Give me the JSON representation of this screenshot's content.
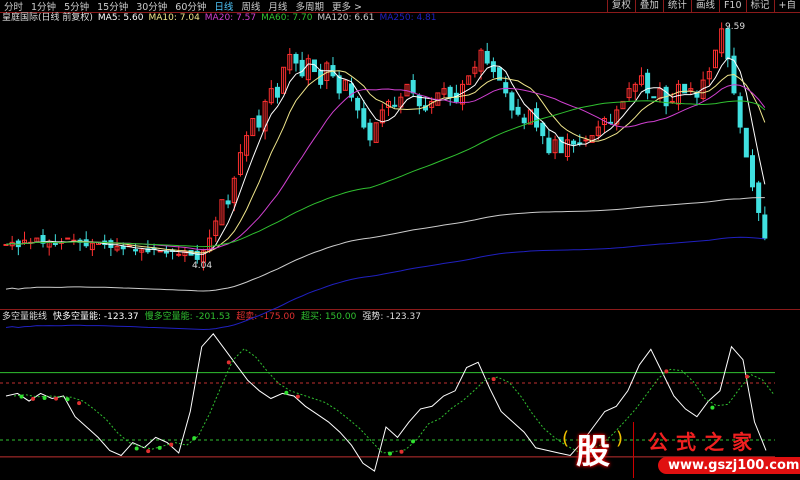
{
  "toolbar": {
    "periods": [
      "分时",
      "1分钟",
      "5分钟",
      "15分钟",
      "30分钟",
      "60分钟",
      "日线",
      "周线",
      "月线",
      "多周期",
      "更多 >"
    ],
    "active": 6,
    "tools": [
      "复权",
      "叠加",
      "统计",
      "画线",
      "F10",
      "标记",
      "+自"
    ]
  },
  "legend": {
    "title": "皇庭国际(日线 前复权)",
    "ma": [
      {
        "label": "MA5: 5.60",
        "color": "#ffffff"
      },
      {
        "label": "MA10: 7.04",
        "color": "#f0e68c"
      },
      {
        "label": "MA20: 7.57",
        "color": "#d040d0"
      },
      {
        "label": "MA60: 7.70",
        "color": "#30c030"
      },
      {
        "label": "MA120: 6.61",
        "color": "#cccccc"
      },
      {
        "label": "MA250: 4.81",
        "color": "#2020c0"
      }
    ]
  },
  "price_labels": {
    "high": "9.59",
    "low": "4.04"
  },
  "colors": {
    "up": "#ff3030",
    "down": "#40e0e0"
  },
  "closes": [
    4.45,
    4.5,
    4.4,
    4.55,
    4.5,
    4.6,
    4.48,
    4.52,
    4.45,
    4.5,
    4.6,
    4.55,
    4.5,
    4.42,
    4.48,
    4.5,
    4.45,
    4.38,
    4.4,
    4.35,
    4.42,
    4.3,
    4.32,
    4.28,
    4.35,
    4.3,
    4.25,
    4.3,
    4.22,
    4.28,
    4.2,
    4.1,
    4.3,
    4.6,
    5.0,
    5.5,
    5.4,
    6.0,
    6.6,
    7.0,
    7.4,
    7.2,
    7.8,
    8.1,
    7.9,
    8.6,
    8.9,
    8.7,
    8.4,
    8.8,
    8.5,
    8.2,
    8.7,
    8.4,
    8.0,
    8.3,
    7.9,
    7.6,
    7.2,
    6.9,
    7.3,
    7.6,
    7.8,
    7.7,
    7.9,
    8.2,
    8.0,
    7.7,
    7.6,
    7.8,
    8.0,
    8.1,
    7.9,
    7.8,
    8.2,
    8.4,
    8.6,
    9.0,
    8.7,
    8.5,
    8.3,
    8.0,
    7.6,
    7.5,
    7.3,
    7.6,
    7.2,
    7.0,
    6.6,
    6.9,
    6.6,
    6.9,
    6.8,
    6.8,
    6.9,
    7.0,
    7.2,
    7.4,
    7.3,
    7.6,
    7.8,
    8.1,
    8.2,
    8.4,
    8.0,
    7.9,
    8.1,
    7.7,
    7.8,
    8.2,
    8.0,
    8.1,
    7.9,
    8.3,
    8.5,
    9.0,
    9.5,
    8.8,
    8.0,
    7.2,
    6.5,
    5.8,
    5.2,
    4.6
  ],
  "indicator": {
    "name": "多空量能线",
    "fast_label": "快多空量能: -123.37",
    "slow_label": "慢多空量能: -201.53",
    "oversold_label": "超卖: -175.00",
    "overbought_label": "超买: 150.00",
    "strong_label": "强势: -123.37",
    "overbought": 150,
    "oversold": -175,
    "upper_dash": 110,
    "lower_dash": -110,
    "fast": [
      60,
      70,
      40,
      70,
      50,
      60,
      -20,
      -60,
      -100,
      -150,
      -170,
      -120,
      -140,
      -100,
      -120,
      -160,
      0,
      250,
      300,
      240,
      180,
      120,
      80,
      50,
      70,
      60,
      20,
      -10,
      -40,
      -80,
      -130,
      -200,
      -230,
      -60,
      -100,
      -40,
      10,
      20,
      60,
      80,
      170,
      190,
      90,
      0,
      -40,
      -80,
      -140,
      -150,
      -160,
      -170,
      -120,
      -60,
      0,
      20,
      80,
      180,
      240,
      150,
      60,
      10,
      -20,
      40,
      80,
      250,
      200,
      -40,
      -150
    ]
  },
  "logo": {
    "char": "股",
    "text": "公式之家",
    "url": "www.gszj100.com"
  }
}
